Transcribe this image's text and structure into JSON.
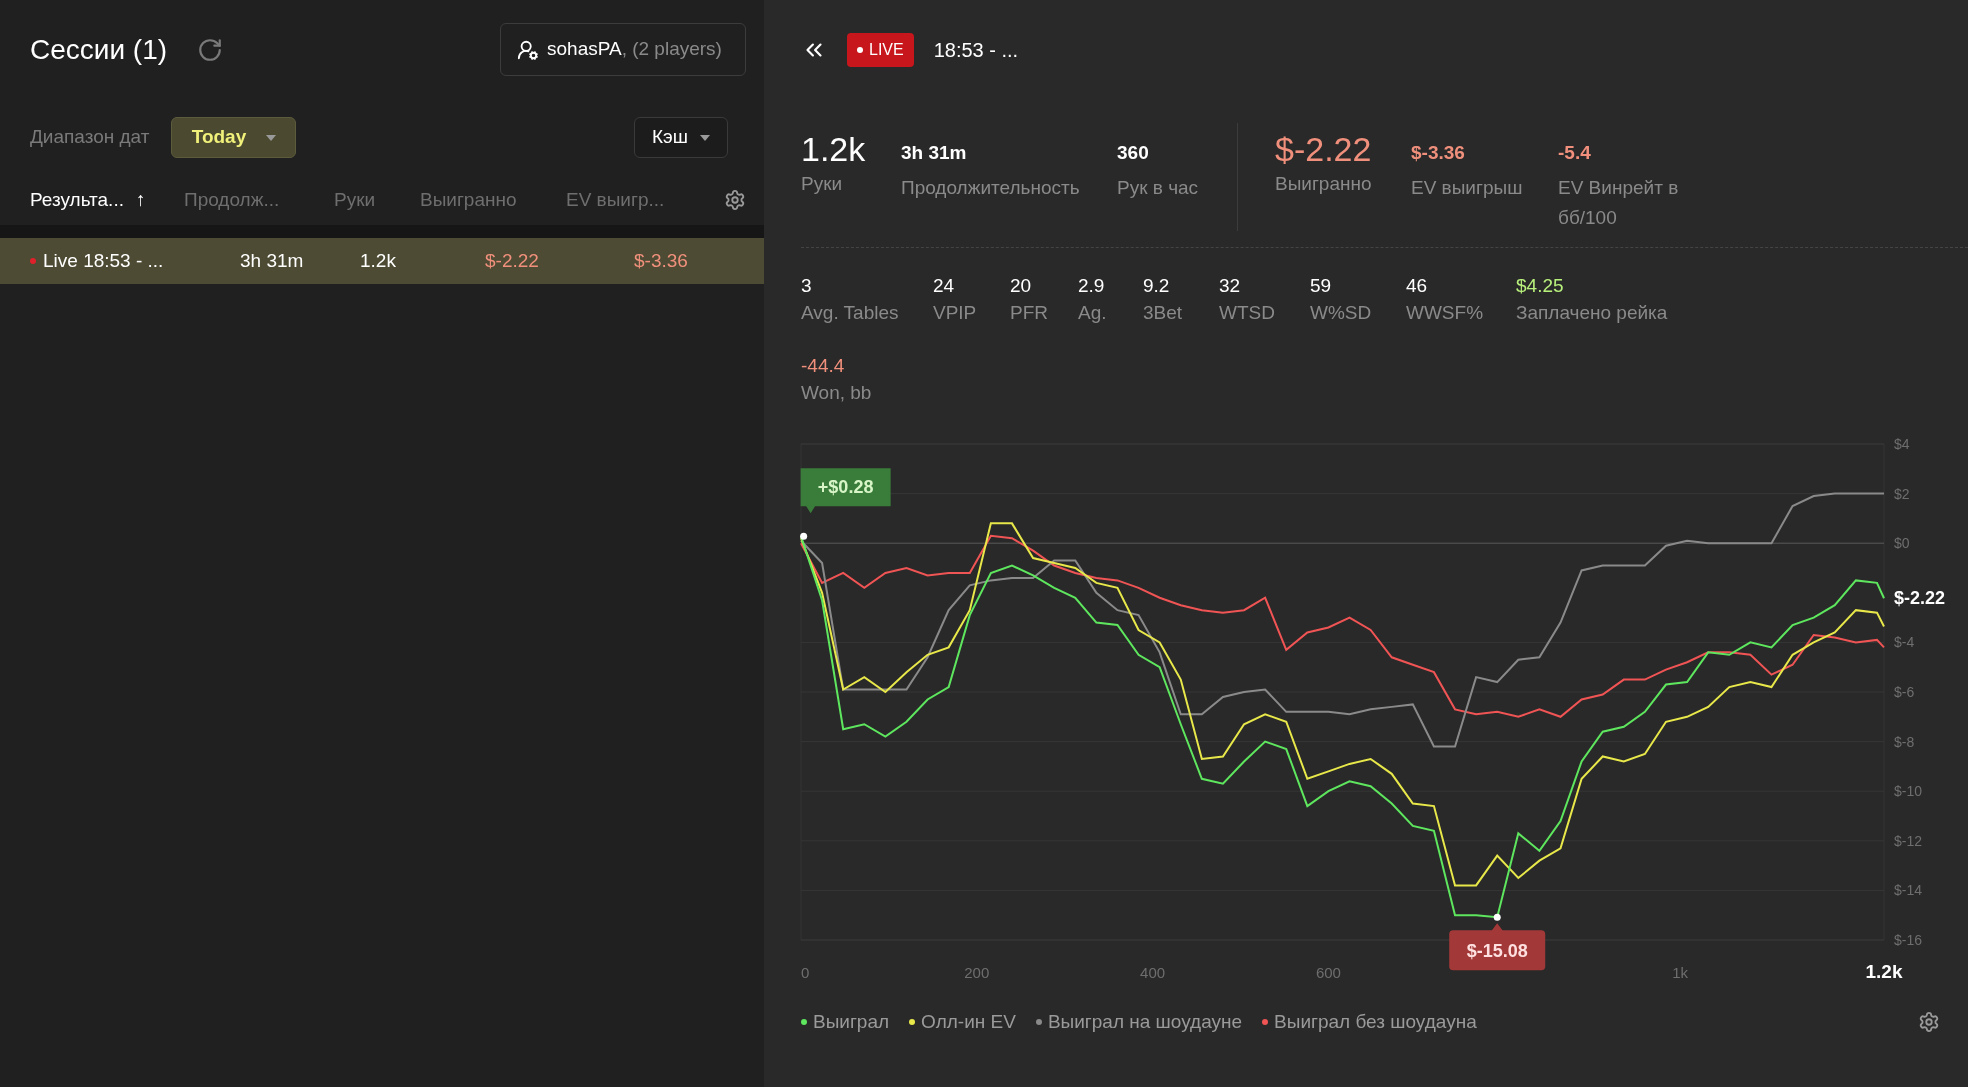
{
  "sidebar": {
    "title": "Сессии (1)",
    "player_button": {
      "name": "sohasPA",
      "suffix": ", (2 players)"
    },
    "filters": {
      "date_label": "Диапазон дат",
      "date_value": "Today",
      "type_value": "Кэш"
    },
    "columns": [
      {
        "label": "Результа...",
        "selected": true,
        "sort_arrow": "↑"
      },
      {
        "label": "Продолж...",
        "selected": false
      },
      {
        "label": "Руки",
        "selected": false
      },
      {
        "label": "Выигранно",
        "selected": false
      },
      {
        "label": "EV выигр...",
        "selected": false
      }
    ],
    "rows": [
      {
        "selected": true,
        "live": true,
        "cells": [
          {
            "text": "Live 18:53 - ...",
            "color": "#ffffff"
          },
          {
            "text": "3h 31m",
            "color": "#ffffff"
          },
          {
            "text": "1.2k",
            "color": "#ffffff"
          },
          {
            "text": "$-2.22",
            "color": "#f0907c"
          },
          {
            "text": "$-3.36",
            "color": "#f0907c"
          }
        ]
      }
    ]
  },
  "session": {
    "badge": "LIVE",
    "title": "18:53 - ...",
    "summary": [
      {
        "value": "1.2k",
        "label": "Руки",
        "kind": "primary",
        "color": "#ffffff"
      },
      {
        "value": "3h 31m",
        "label": "Продолжительность",
        "kind": "secondary",
        "color": "#ffffff"
      },
      {
        "value": "360",
        "label": "Рук в час",
        "kind": "secondary",
        "color": "#ffffff"
      }
    ],
    "results": [
      {
        "value": "$-2.22",
        "label": "Выигранно",
        "kind": "primary",
        "color": "#f0907c"
      },
      {
        "value": "$-3.36",
        "label": "EV выигрыш",
        "kind": "secondary",
        "color": "#f0907c"
      },
      {
        "value": "-5.4",
        "label": "EV Винрейт в бб/100",
        "kind": "secondary",
        "color": "#f0907c"
      }
    ],
    "stats": [
      {
        "value": "3",
        "label": "Avg. Tables",
        "color": "#ffffff"
      },
      {
        "value": "24",
        "label": "VPIP",
        "color": "#ffffff"
      },
      {
        "value": "20",
        "label": "PFR",
        "color": "#ffffff"
      },
      {
        "value": "2.9",
        "label": "Ag.",
        "color": "#ffffff"
      },
      {
        "value": "9.2",
        "label": "3Bet",
        "color": "#ffffff"
      },
      {
        "value": "32",
        "label": "WTSD",
        "color": "#ffffff"
      },
      {
        "value": "59",
        "label": "W%SD",
        "color": "#ffffff"
      },
      {
        "value": "46",
        "label": "WWSF%",
        "color": "#ffffff"
      },
      {
        "value": "$4.25",
        "label": "Заплачено рейка",
        "color": "#b8f07c"
      }
    ],
    "stats_extra": [
      {
        "value": "-44.4",
        "label": "Won, bb",
        "color": "#f0907c"
      }
    ],
    "chart_data": {
      "type": "line",
      "grid": true,
      "x": [
        0,
        24,
        48,
        72,
        96,
        120,
        144,
        168,
        192,
        216,
        240,
        264,
        288,
        312,
        336,
        360,
        384,
        408,
        432,
        456,
        480,
        504,
        528,
        552,
        576,
        600,
        624,
        648,
        672,
        696,
        720,
        744,
        768,
        792,
        816,
        840,
        864,
        888,
        912,
        936,
        960,
        984,
        1008,
        1032,
        1056,
        1080,
        1104,
        1128,
        1152,
        1176,
        1200,
        1224,
        1232
      ],
      "series": [
        {
          "name": "Выиграл",
          "color": "#5ee65e",
          "values": [
            0.28,
            -2.3,
            -7.5,
            -7.3,
            -7.8,
            -7.2,
            -6.3,
            -5.8,
            -2.9,
            -1.2,
            -0.9,
            -1.3,
            -1.8,
            -2.2,
            -3.2,
            -3.3,
            -4.5,
            -5.0,
            -7.3,
            -9.5,
            -9.7,
            -8.8,
            -8.0,
            -8.3,
            -10.6,
            -10.0,
            -9.6,
            -9.8,
            -10.5,
            -11.4,
            -11.6,
            -15.0,
            -15.0,
            -15.08,
            -11.7,
            -12.4,
            -11.2,
            -8.8,
            -7.6,
            -7.4,
            -6.8,
            -5.7,
            -5.6,
            -4.4,
            -4.5,
            -4.0,
            -4.2,
            -3.3,
            -3.0,
            -2.5,
            -1.5,
            -1.6,
            -2.22
          ]
        },
        {
          "name": "Олл-ин EV",
          "color": "#e8e84a",
          "values": [
            0.2,
            -2.0,
            -5.9,
            -5.4,
            -6.0,
            -5.2,
            -4.5,
            -4.2,
            -2.7,
            0.8,
            0.8,
            -0.6,
            -0.8,
            -1.0,
            -1.6,
            -1.8,
            -3.5,
            -4.0,
            -5.5,
            -8.7,
            -8.6,
            -7.3,
            -6.9,
            -7.2,
            -9.5,
            -9.2,
            -8.9,
            -8.7,
            -9.3,
            -10.5,
            -10.6,
            -13.8,
            -13.8,
            -12.6,
            -13.5,
            -12.8,
            -12.3,
            -9.5,
            -8.6,
            -8.8,
            -8.5,
            -7.2,
            -7.0,
            -6.6,
            -5.8,
            -5.6,
            -5.8,
            -4.5,
            -4.0,
            -3.6,
            -2.7,
            -2.8,
            -3.36
          ]
        },
        {
          "name": "Выиграл на шоудауне",
          "color": "#8a8a8a",
          "values": [
            0.1,
            -0.8,
            -5.9,
            -5.9,
            -5.9,
            -5.9,
            -4.6,
            -2.7,
            -1.7,
            -1.5,
            -1.4,
            -1.4,
            -0.7,
            -0.7,
            -2.0,
            -2.7,
            -2.9,
            -4.4,
            -6.9,
            -6.9,
            -6.2,
            -6.0,
            -5.9,
            -6.8,
            -6.8,
            -6.8,
            -6.9,
            -6.7,
            -6.6,
            -6.5,
            -8.2,
            -8.2,
            -5.4,
            -5.6,
            -4.7,
            -4.6,
            -3.2,
            -1.1,
            -0.9,
            -0.9,
            -0.9,
            -0.1,
            0.1,
            0.0,
            0.0,
            0.0,
            0.0,
            1.5,
            1.9,
            2.0,
            2.0,
            2.0,
            2.0
          ]
        },
        {
          "name": "Выиграл без шоудауна",
          "color": "#f05454",
          "values": [
            0.0,
            -1.6,
            -1.2,
            -1.8,
            -1.2,
            -1.0,
            -1.3,
            -1.2,
            -1.2,
            0.3,
            0.2,
            -0.3,
            -0.9,
            -1.2,
            -1.4,
            -1.5,
            -1.8,
            -2.2,
            -2.5,
            -2.7,
            -2.8,
            -2.7,
            -2.2,
            -4.3,
            -3.6,
            -3.4,
            -3.0,
            -3.5,
            -4.6,
            -4.9,
            -5.2,
            -6.7,
            -6.9,
            -6.8,
            -7.0,
            -6.7,
            -7.0,
            -6.3,
            -6.1,
            -5.5,
            -5.5,
            -5.1,
            -4.8,
            -4.4,
            -4.4,
            -4.5,
            -5.3,
            -4.9,
            -3.7,
            -3.8,
            -4.0,
            -3.9,
            -4.2
          ]
        }
      ],
      "xlim": [
        0,
        1232
      ],
      "ylim": [
        -16,
        4
      ],
      "xticks": [
        0,
        200,
        400,
        600,
        {
          "value": 1000,
          "label": "1k"
        },
        {
          "value": 1232,
          "label": "1.2k"
        }
      ],
      "yticks": [
        {
          "value": -16,
          "label": "$-16"
        },
        {
          "value": -14,
          "label": "$-14"
        },
        {
          "value": -12,
          "label": "$-12"
        },
        {
          "value": -10,
          "label": "$-10"
        },
        {
          "value": -8,
          "label": "$-8"
        },
        {
          "value": -6,
          "label": "$-6"
        },
        {
          "value": -4,
          "label": "$-4"
        },
        {
          "value": 0,
          "label": "$0"
        },
        {
          "value": 2,
          "label": "$2"
        },
        {
          "value": 4,
          "label": "$4"
        }
      ],
      "annotations": [
        {
          "x": 3,
          "y": 0.28,
          "text": "+$0.28"
        },
        {
          "x": 792,
          "y": -15.08,
          "text": "$-15.08"
        },
        {
          "x": 1232,
          "y": -2.22,
          "text": "$-2.22"
        }
      ]
    }
  }
}
